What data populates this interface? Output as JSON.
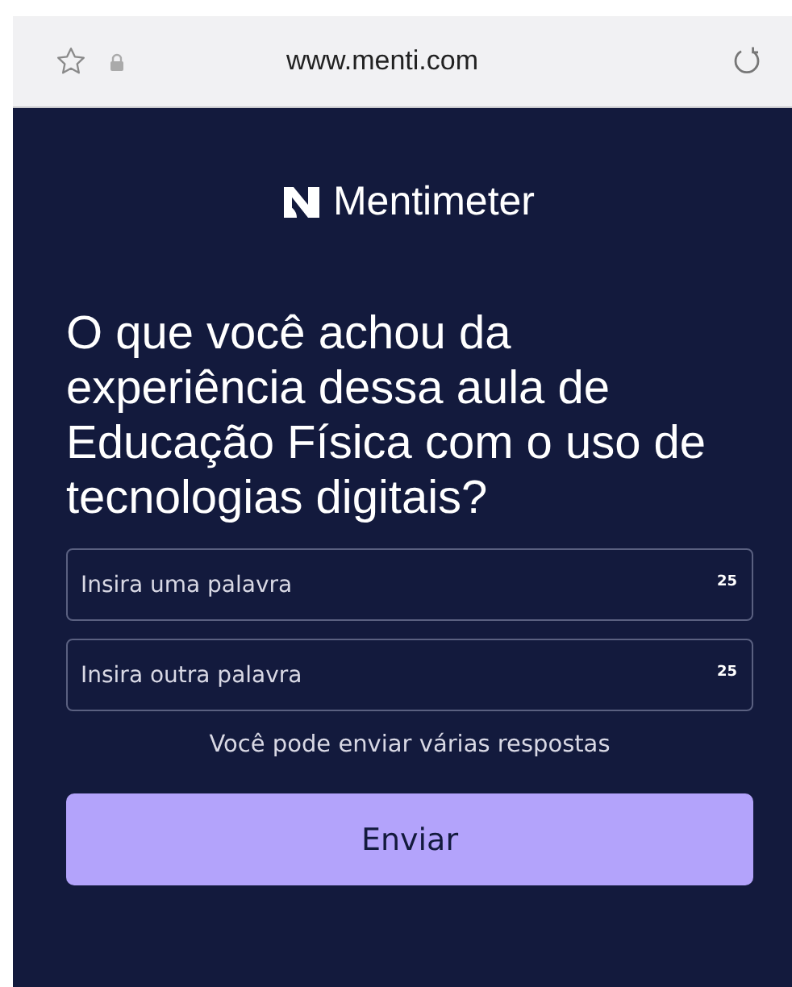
{
  "browser": {
    "url": "www.menti.com"
  },
  "logo": {
    "text": "Mentimeter"
  },
  "question": "O que você achou da experiência dessa aula de Educação Física com o uso de tecnologias digitais?",
  "fields": [
    {
      "placeholder": "Insira uma palavra",
      "counter": "25"
    },
    {
      "placeholder": "Insira outra palavra",
      "counter": "25"
    }
  ],
  "hint": "Você pode enviar várias respostas",
  "buttons": [
    "Enviar"
  ]
}
